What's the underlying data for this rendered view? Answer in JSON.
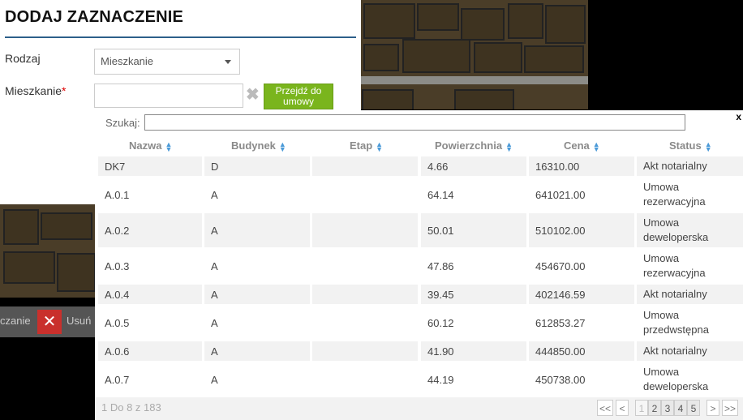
{
  "form": {
    "title": "DODAJ ZAZNACZENIE",
    "rodzaj_label": "Rodzaj",
    "rodzaj_value": "Mieszkanie",
    "mieszkanie_label": "Mieszkanie",
    "required_mark": "*",
    "mieszkanie_value": "",
    "clear_icon": "✖",
    "goto_button": "Przejdź do umowy"
  },
  "background": {
    "bottombar_text": "czanie",
    "delete_icon": "✕",
    "delete_text": "Usuń"
  },
  "popup": {
    "close": "x",
    "search_label": "Szukaj:",
    "search_value": "",
    "columns": [
      "Nazwa",
      "Budynek",
      "Etap",
      "Powierzchnia",
      "Cena",
      "Status"
    ],
    "rows": [
      {
        "nazwa": "DK7",
        "budynek": "D",
        "etap": "",
        "powierzchnia": "4.66",
        "cena": "16310.00",
        "status": "Akt notarialny"
      },
      {
        "nazwa": "A.0.1",
        "budynek": "A",
        "etap": "",
        "powierzchnia": "64.14",
        "cena": "641021.00",
        "status": "Umowa rezerwacyjna"
      },
      {
        "nazwa": "A.0.2",
        "budynek": "A",
        "etap": "",
        "powierzchnia": "50.01",
        "cena": "510102.00",
        "status": "Umowa deweloperska"
      },
      {
        "nazwa": "A.0.3",
        "budynek": "A",
        "etap": "",
        "powierzchnia": "47.86",
        "cena": "454670.00",
        "status": "Umowa rezerwacyjna"
      },
      {
        "nazwa": "A.0.4",
        "budynek": "A",
        "etap": "",
        "powierzchnia": "39.45",
        "cena": "402146.59",
        "status": "Akt notarialny"
      },
      {
        "nazwa": "A.0.5",
        "budynek": "A",
        "etap": "",
        "powierzchnia": "60.12",
        "cena": "612853.27",
        "status": "Umowa przedwstępna"
      },
      {
        "nazwa": "A.0.6",
        "budynek": "A",
        "etap": "",
        "powierzchnia": "41.90",
        "cena": "444850.00",
        "status": "Akt notarialny"
      },
      {
        "nazwa": "A.0.7",
        "budynek": "A",
        "etap": "",
        "powierzchnia": "44.19",
        "cena": "450738.00",
        "status": "Umowa deweloperska"
      }
    ],
    "info": "1 Do 8 z 183",
    "pager": {
      "first": "<<",
      "prev": "<",
      "pages": [
        "1",
        "2",
        "3",
        "4",
        "5"
      ],
      "next": ">",
      "last": ">>"
    }
  }
}
